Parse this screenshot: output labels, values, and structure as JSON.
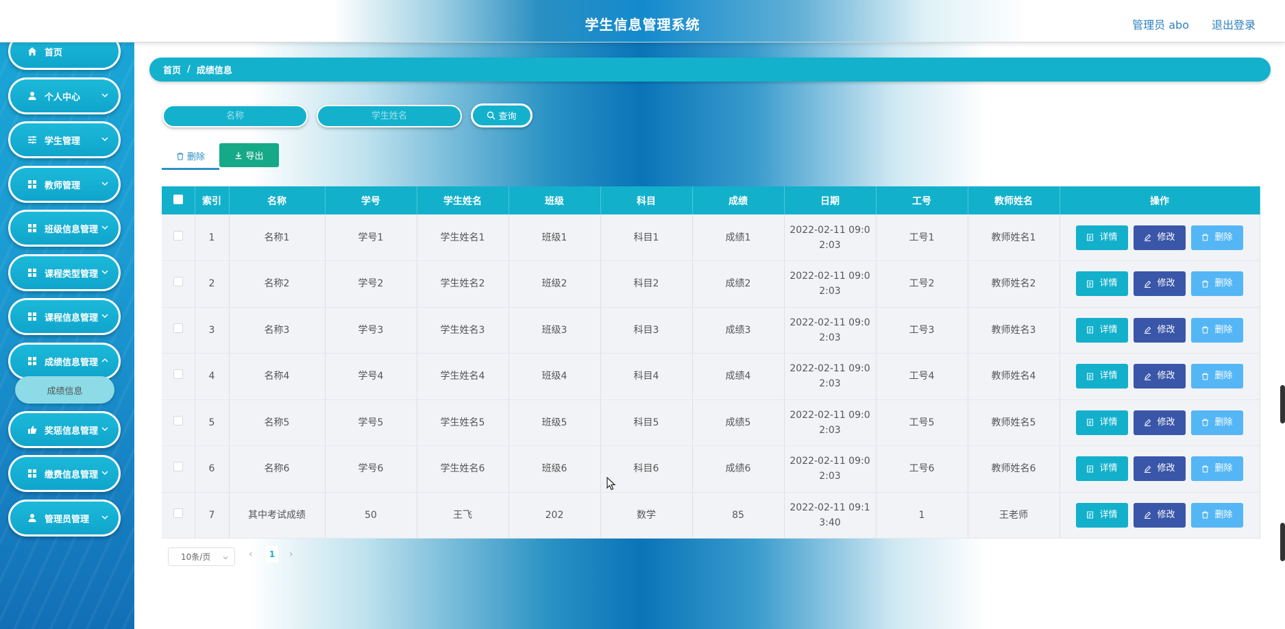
{
  "header": {
    "title": "学生信息管理系统",
    "user": "管理员 abo",
    "logout": "退出登录"
  },
  "sidebar": {
    "items": [
      {
        "label": "首页",
        "icon": "home-icon"
      },
      {
        "label": "个人中心",
        "icon": "user-icon"
      },
      {
        "label": "学生管理",
        "icon": "sliders-icon"
      },
      {
        "label": "教师管理",
        "icon": "grid-icon"
      },
      {
        "label": "班级信息管理",
        "icon": "grid-icon"
      },
      {
        "label": "课程类型管理",
        "icon": "grid-icon"
      },
      {
        "label": "课程信息管理",
        "icon": "grid-icon"
      },
      {
        "label": "成绩信息管理",
        "icon": "grid-icon"
      },
      {
        "label": "奖惩信息管理",
        "icon": "thumb-icon"
      },
      {
        "label": "缴费信息管理",
        "icon": "grid-icon"
      },
      {
        "label": "管理员管理",
        "icon": "user-icon"
      }
    ],
    "subitem": "成绩信息"
  },
  "breadcrumb": {
    "home": "首页",
    "separator": "/",
    "current": "成绩信息"
  },
  "search": {
    "name_placeholder": "名称",
    "student_placeholder": "学生姓名",
    "button": "查询"
  },
  "actions": {
    "delete": "删除",
    "export": "导出"
  },
  "table": {
    "headers": [
      "索引",
      "名称",
      "学号",
      "学生姓名",
      "班级",
      "科目",
      "成绩",
      "日期",
      "工号",
      "教师姓名",
      "操作"
    ],
    "rows": [
      {
        "index": "1",
        "name": "名称1",
        "sid": "学号1",
        "student": "学生姓名1",
        "class": "班级1",
        "subject": "科目1",
        "score": "成绩1",
        "date_a": "2022-02-11 09:0",
        "date_b": "2:03",
        "tid": "工号1",
        "teacher": "教师姓名1"
      },
      {
        "index": "2",
        "name": "名称2",
        "sid": "学号2",
        "student": "学生姓名2",
        "class": "班级2",
        "subject": "科目2",
        "score": "成绩2",
        "date_a": "2022-02-11 09:0",
        "date_b": "2:03",
        "tid": "工号2",
        "teacher": "教师姓名2"
      },
      {
        "index": "3",
        "name": "名称3",
        "sid": "学号3",
        "student": "学生姓名3",
        "class": "班级3",
        "subject": "科目3",
        "score": "成绩3",
        "date_a": "2022-02-11 09:0",
        "date_b": "2:03",
        "tid": "工号3",
        "teacher": "教师姓名3"
      },
      {
        "index": "4",
        "name": "名称4",
        "sid": "学号4",
        "student": "学生姓名4",
        "class": "班级4",
        "subject": "科目4",
        "score": "成绩4",
        "date_a": "2022-02-11 09:0",
        "date_b": "2:03",
        "tid": "工号4",
        "teacher": "教师姓名4"
      },
      {
        "index": "5",
        "name": "名称5",
        "sid": "学号5",
        "student": "学生姓名5",
        "class": "班级5",
        "subject": "科目5",
        "score": "成绩5",
        "date_a": "2022-02-11 09:0",
        "date_b": "2:03",
        "tid": "工号5",
        "teacher": "教师姓名5"
      },
      {
        "index": "6",
        "name": "名称6",
        "sid": "学号6",
        "student": "学生姓名6",
        "class": "班级6",
        "subject": "科目6",
        "score": "成绩6",
        "date_a": "2022-02-11 09:0",
        "date_b": "2:03",
        "tid": "工号6",
        "teacher": "教师姓名6"
      },
      {
        "index": "7",
        "name": "其中考试成绩",
        "sid": "50",
        "student": "王飞",
        "class": "202",
        "subject": "数学",
        "score": "85",
        "date_a": "2022-02-11 09:1",
        "date_b": "3:40",
        "tid": "1",
        "teacher": "王老师"
      }
    ],
    "row_actions": {
      "detail": "详情",
      "edit": "修改",
      "delete": "删除"
    }
  },
  "pagination": {
    "page_size": "10条/页",
    "current_page": "1",
    "prev": "‹",
    "next": "›"
  },
  "colors": {
    "accent": "#12b0cb",
    "edit": "#3a56a8",
    "delete": "#55b6f5",
    "export": "#16a987"
  }
}
